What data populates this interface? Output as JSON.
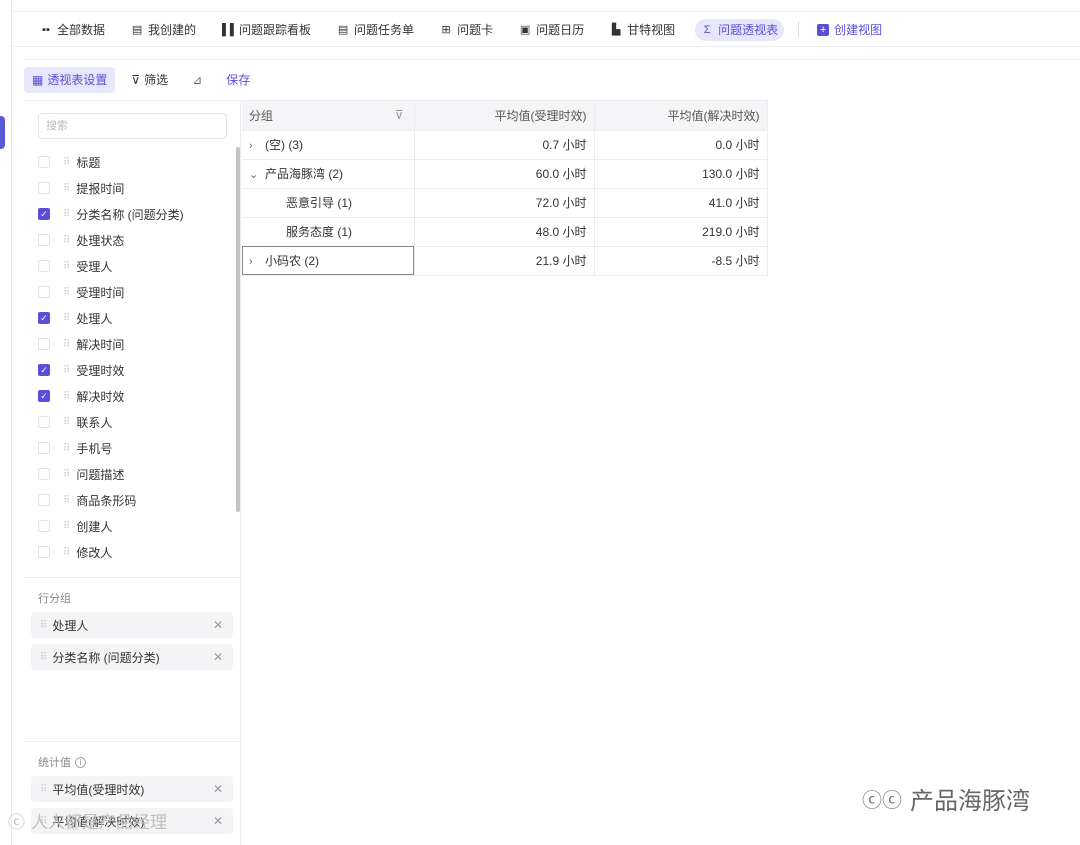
{
  "views": [
    {
      "icon": "grid-icon",
      "glyph": "▪▪",
      "label": "全部数据"
    },
    {
      "icon": "table-icon",
      "glyph": "▤",
      "label": "我创建的"
    },
    {
      "icon": "kanban-icon",
      "glyph": "▌▌",
      "label": "问题跟踪看板"
    },
    {
      "icon": "list-icon",
      "glyph": "▤",
      "label": "问题任务单"
    },
    {
      "icon": "card-icon",
      "glyph": "⊞",
      "label": "问题卡"
    },
    {
      "icon": "calendar-icon",
      "glyph": "▣",
      "label": "问题日历"
    },
    {
      "icon": "gantt-icon",
      "glyph": "▙",
      "label": "甘特视图"
    },
    {
      "icon": "pivot-icon",
      "glyph": "Σ",
      "label": "问题透视表",
      "active": true
    }
  ],
  "create_view": {
    "glyph": "+",
    "label": "创建视图"
  },
  "toolbar": {
    "pivot_settings": "透视表设置",
    "filter": "筛选",
    "chart_glyph": "📈",
    "save": "保存"
  },
  "panel": {
    "search_placeholder": "搜索",
    "fields": [
      {
        "label": "标题",
        "checked": false
      },
      {
        "label": "提报时间",
        "checked": false
      },
      {
        "label": "分类名称 (问题分类)",
        "checked": true
      },
      {
        "label": "处理状态",
        "checked": false
      },
      {
        "label": "受理人",
        "checked": false
      },
      {
        "label": "受理时间",
        "checked": false
      },
      {
        "label": "处理人",
        "checked": true
      },
      {
        "label": "解决时间",
        "checked": false
      },
      {
        "label": "受理时效",
        "checked": true
      },
      {
        "label": "解决时效",
        "checked": true
      },
      {
        "label": "联系人",
        "checked": false
      },
      {
        "label": "手机号",
        "checked": false
      },
      {
        "label": "问题描述",
        "checked": false
      },
      {
        "label": "商品条形码",
        "checked": false
      },
      {
        "label": "创建人",
        "checked": false
      },
      {
        "label": "修改人",
        "checked": false
      }
    ],
    "row_group_title": "行分组",
    "row_groups": [
      "处理人",
      "分类名称 (问题分类)"
    ],
    "stats_title": "统计值",
    "stats": [
      "平均值(受理时效)",
      "平均值(解决时效)"
    ]
  },
  "grid": {
    "headers": [
      "分组",
      "平均值(受理时效)",
      "平均值(解决时效)"
    ],
    "rows": [
      {
        "caret": ">",
        "group": "(空) (3)",
        "v1": "0.7 小时",
        "v2": "0.0 小时",
        "level": 0
      },
      {
        "caret": "v",
        "group": "产品海豚湾 (2)",
        "v1": "60.0 小时",
        "v2": "130.0 小时",
        "level": 0
      },
      {
        "caret": "",
        "group": "恶意引导 (1)",
        "v1": "72.0 小时",
        "v2": "41.0 小时",
        "level": 1
      },
      {
        "caret": "",
        "group": "服务态度 (1)",
        "v1": "48.0 小时",
        "v2": "219.0 小时",
        "level": 1
      },
      {
        "caret": ">",
        "group": "小码农 (2)",
        "v1": "21.9 小时",
        "v2": "-8.5 小时",
        "level": 0,
        "selected": true
      }
    ]
  },
  "watermark": {
    "text": "产品海豚湾",
    "glyph": "ⓒⓒ"
  },
  "watermark2": {
    "text": "人人都是产品经理"
  }
}
